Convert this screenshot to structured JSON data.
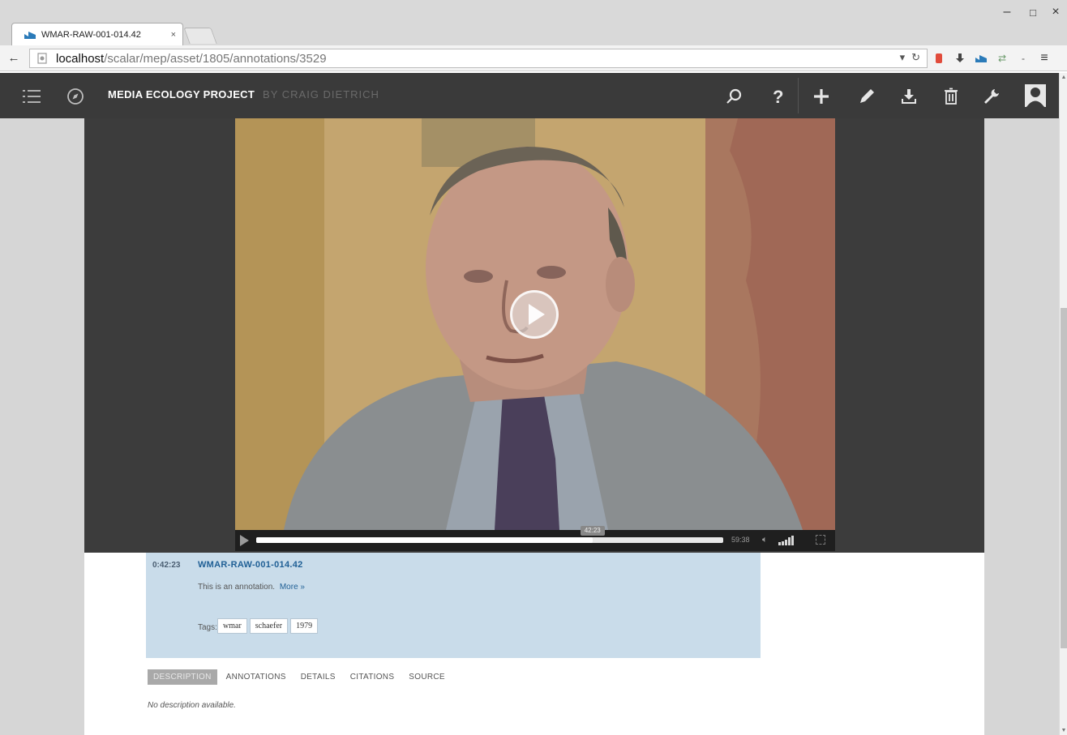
{
  "browser": {
    "tab_title": "WMAR-RAW-001-014.42",
    "tab_close": "×",
    "url_host": "localhost",
    "url_path": "/scalar/mep/asset/1805/annotations/3529",
    "back": "←",
    "minimize": "–",
    "maximize": "□",
    "close": "×",
    "menu": "≡"
  },
  "app": {
    "title": "MEDIA ECOLOGY PROJECT",
    "author": "BY CRAIG DIETRICH",
    "colors": {
      "header": "#3a3a3a",
      "accent": "#1f5f95"
    }
  },
  "player": {
    "playhead_label": "42:23",
    "duration": "59:38",
    "progress": 0.72,
    "volume_levels": [
      0.3,
      0.45,
      0.6,
      0.8,
      1.0
    ]
  },
  "annotation": {
    "time": "0:42:23",
    "title": "WMAR-RAW-001-014.42",
    "description": "This is an annotation.",
    "more_link": "More »",
    "tags_label": "Tags:",
    "tags": [
      "wmar",
      "schaefer",
      "1979"
    ]
  },
  "tabs": [
    "DESCRIPTION",
    "ANNOTATIONS",
    "DETAILS",
    "CITATIONS",
    "SOURCE"
  ],
  "description_text": "No description available.",
  "icons": [
    "menu-icon",
    "compass-icon",
    "search-icon",
    "help-icon",
    "add-icon",
    "edit-icon",
    "import-icon",
    "delete-icon",
    "wrench-icon",
    "user-icon"
  ]
}
